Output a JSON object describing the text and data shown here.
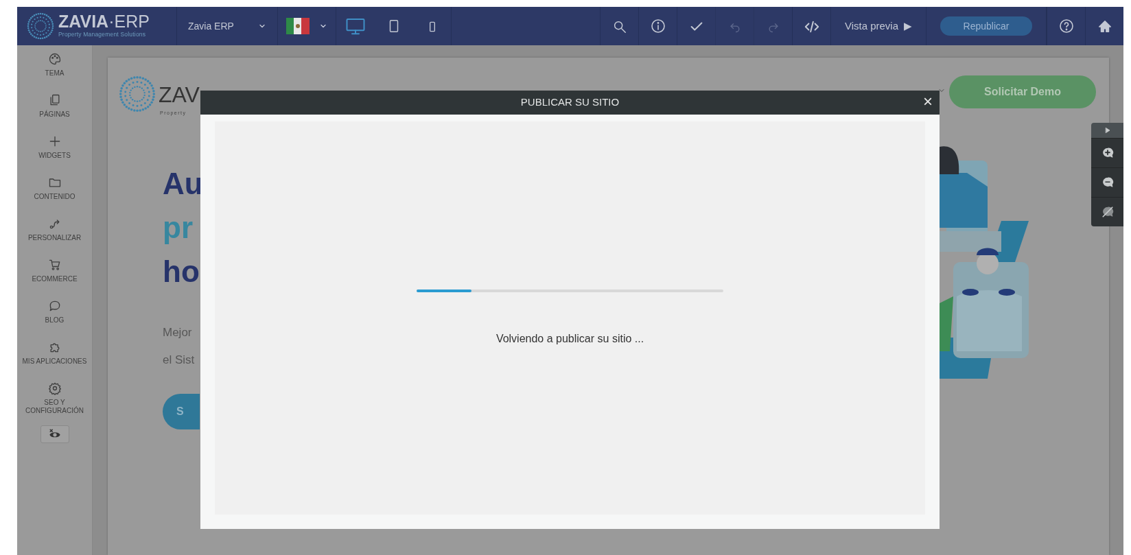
{
  "topbar": {
    "logo": {
      "brand": "ZAVIA",
      "suffix": "·ERP",
      "tagline": "Property Management Solutions"
    },
    "site_selector": {
      "label": "Zavia ERP"
    },
    "devices": [
      {
        "kind": "desktop",
        "selected": true
      },
      {
        "kind": "tablet",
        "selected": false
      },
      {
        "kind": "phone",
        "selected": false
      }
    ],
    "tools": [
      {
        "kind": "search",
        "disabled": false
      },
      {
        "kind": "info",
        "disabled": false
      },
      {
        "kind": "check",
        "disabled": false
      },
      {
        "kind": "undo",
        "disabled": true
      },
      {
        "kind": "redo",
        "disabled": true
      },
      {
        "kind": "code",
        "disabled": false
      }
    ],
    "preview": {
      "label": "Vista previa",
      "icon": "▶"
    },
    "publish": {
      "label": "Republicar",
      "disabled": true
    },
    "end_tools": [
      {
        "kind": "help"
      },
      {
        "kind": "home"
      }
    ]
  },
  "sidebar": {
    "items": [
      {
        "kind": "palette",
        "label": "TEMA"
      },
      {
        "kind": "pages",
        "label": "PÁGINAS"
      },
      {
        "kind": "plus",
        "label": "WIDGETS"
      },
      {
        "kind": "folder",
        "label": "CONTENIDO"
      },
      {
        "kind": "route",
        "label": "PERSONALIZAR"
      },
      {
        "kind": "cart",
        "label": "ECOMMERCE"
      },
      {
        "kind": "chat",
        "label": "BLOG"
      },
      {
        "kind": "puzzle",
        "label": "MIS APLICACIONES"
      },
      {
        "kind": "gear",
        "label": "SEO Y CONFIGURACIÓN"
      }
    ],
    "visibility_toggle": {
      "kind": "eye"
    }
  },
  "site_preview": {
    "logo_text": "ZAV",
    "tagline": "Property",
    "headline": [
      {
        "text": "Au",
        "color": "#26336a"
      },
      {
        "text": "pr",
        "color": "#37879f"
      },
      {
        "text": "ho",
        "color": "#26336a"
      }
    ],
    "paragraph": [
      "Mejor",
      "el Sist"
    ],
    "cta": "S",
    "demo_button": "Solicitar Demo",
    "illustration": {
      "kind": "picture"
    }
  },
  "float_toolbar": [
    {
      "kind": "collapse"
    },
    {
      "kind": "add-comment"
    },
    {
      "kind": "comments"
    },
    {
      "kind": "hide-comments"
    }
  ],
  "modal": {
    "title": "PUBLICAR SU SITIO",
    "close": "×",
    "progress": {
      "level": 0.18
    },
    "message": "Volviendo a publicar su sitio ..."
  }
}
